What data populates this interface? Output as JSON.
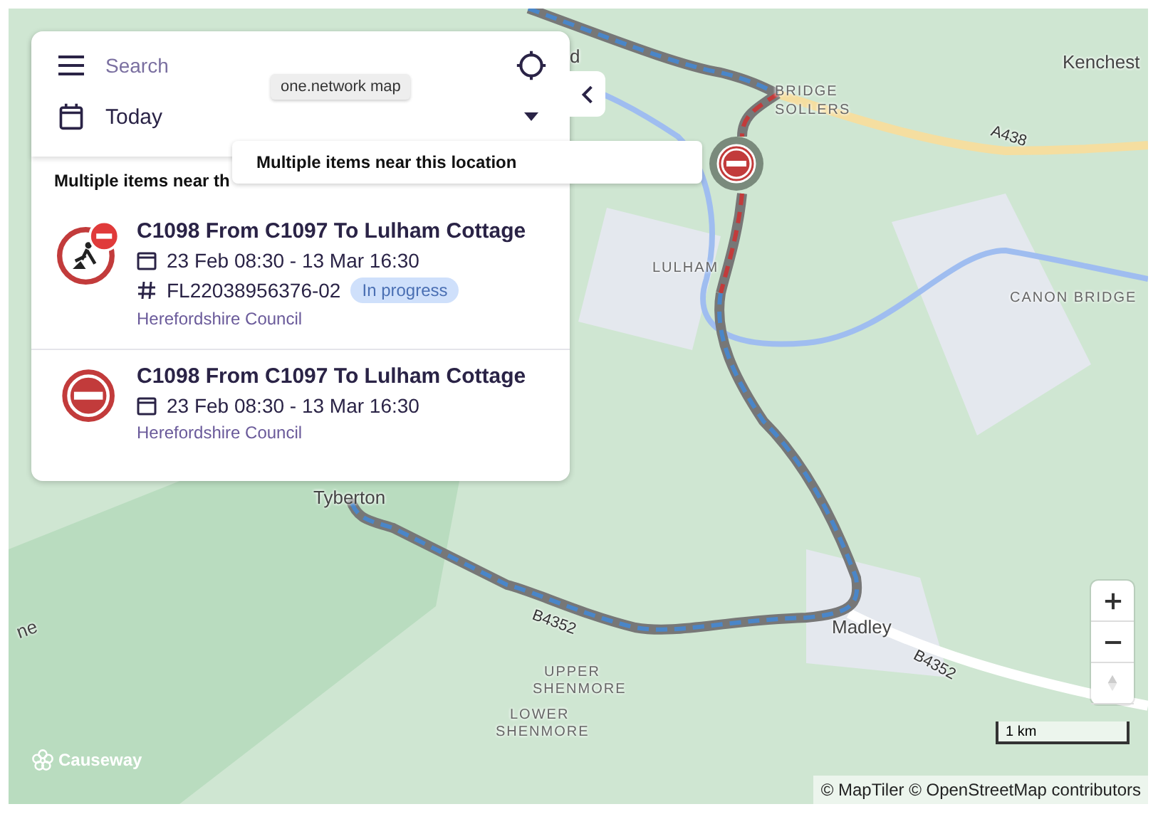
{
  "search": {
    "placeholder": "Search"
  },
  "date_filter": {
    "value": "Today"
  },
  "tooltip": "one.network map",
  "results_header": "Multiple items near th",
  "results": [
    {
      "kind": "roadworks",
      "title": "C1098 From C1097 To Lulham Cottage",
      "dates": "23 Feb 08:30 - 13 Mar 16:30",
      "reference": "FL22038956376-02",
      "status": "In progress",
      "authority": "Herefordshire Council"
    },
    {
      "kind": "closure",
      "title": "C1098 From C1097 To Lulham Cottage",
      "dates": "23 Feb 08:30 - 13 Mar 16:30",
      "authority": "Herefordshire Council"
    }
  ],
  "map": {
    "popup": "Multiple items near this location",
    "labels": [
      {
        "kind": "town",
        "text": "d"
      },
      {
        "kind": "village",
        "text": "BRIDGE"
      },
      {
        "kind": "village",
        "text": "SOLLERS"
      },
      {
        "kind": "town",
        "text": "Kenchest"
      },
      {
        "kind": "road",
        "text": "A438"
      },
      {
        "kind": "village",
        "text": "LULHAM"
      },
      {
        "kind": "village",
        "text": "CANON BRIDGE"
      },
      {
        "kind": "town",
        "text": "Tyberton"
      },
      {
        "kind": "road",
        "text": "B4352"
      },
      {
        "kind": "town",
        "text": "Madley"
      },
      {
        "kind": "road",
        "text": "B4352"
      },
      {
        "kind": "village",
        "text": "UPPER"
      },
      {
        "kind": "village",
        "text": "SHENMORE"
      },
      {
        "kind": "village",
        "text": "LOWER"
      },
      {
        "kind": "village",
        "text": "SHENMORE"
      },
      {
        "kind": "town",
        "text": "ne"
      }
    ],
    "logo": "Causeway",
    "scale": "1 km",
    "attribution": "© MapTiler © OpenStreetMap contributors"
  }
}
